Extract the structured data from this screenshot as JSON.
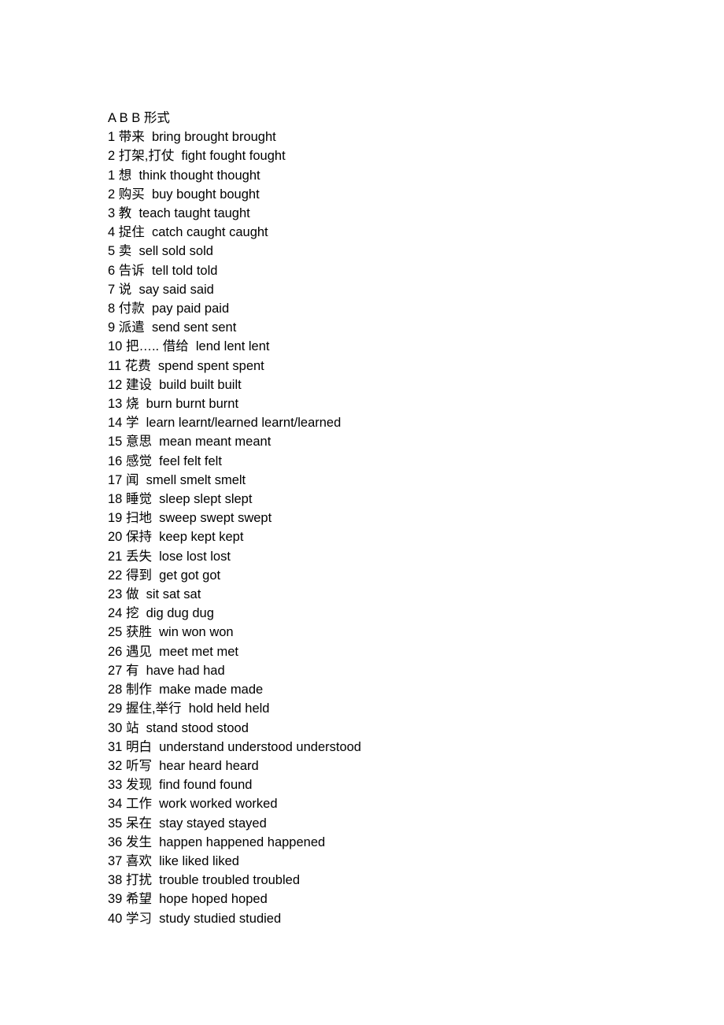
{
  "document": {
    "title": "A B B 形式",
    "background_color": "#ffffff",
    "text_color": "#000000",
    "separator_number_gloss": " ",
    "separator_gloss_forms": "  ",
    "entries": [
      {
        "number": "1",
        "gloss": "带来",
        "forms": "bring brought brought"
      },
      {
        "number": "2",
        "gloss": "打架,打仗",
        "forms": "fight fought fought"
      },
      {
        "number": "1",
        "gloss": "想",
        "forms": "think thought thought"
      },
      {
        "number": "2",
        "gloss": "购买",
        "forms": "buy bought bought"
      },
      {
        "number": "3",
        "gloss": "教",
        "forms": "teach taught taught"
      },
      {
        "number": "4",
        "gloss": "捉住",
        "forms": "catch caught caught"
      },
      {
        "number": "5",
        "gloss": "卖",
        "forms": "sell sold sold"
      },
      {
        "number": "6",
        "gloss": "告诉",
        "forms": "tell told told"
      },
      {
        "number": "7",
        "gloss": "说",
        "forms": "say said said"
      },
      {
        "number": "8",
        "gloss": "付款",
        "forms": "pay paid paid"
      },
      {
        "number": "9",
        "gloss": "派遣",
        "forms": "send sent sent"
      },
      {
        "number": "10",
        "gloss": "把….. 借给",
        "forms": "lend lent lent"
      },
      {
        "number": "11",
        "gloss": "花费",
        "forms": "spend spent spent"
      },
      {
        "number": "12",
        "gloss": "建设",
        "forms": "build built built"
      },
      {
        "number": "13",
        "gloss": "烧",
        "forms": "burn burnt burnt"
      },
      {
        "number": "14",
        "gloss": "学",
        "forms": "learn learnt/learned learnt/learned"
      },
      {
        "number": "15",
        "gloss": "意思",
        "forms": "mean meant meant"
      },
      {
        "number": "16",
        "gloss": "感觉",
        "forms": "feel felt felt"
      },
      {
        "number": "17",
        "gloss": "闻",
        "forms": "smell smelt smelt"
      },
      {
        "number": "18",
        "gloss": "睡觉",
        "forms": "sleep slept slept"
      },
      {
        "number": "19",
        "gloss": "扫地",
        "forms": "sweep swept swept"
      },
      {
        "number": "20",
        "gloss": "保持",
        "forms": "keep kept kept"
      },
      {
        "number": "21",
        "gloss": "丢失",
        "forms": "lose lost lost"
      },
      {
        "number": "22",
        "gloss": "得到",
        "forms": "get got got"
      },
      {
        "number": "23",
        "gloss": "做",
        "forms": "sit sat sat"
      },
      {
        "number": "24",
        "gloss": "挖",
        "forms": "dig dug dug"
      },
      {
        "number": "25",
        "gloss": "获胜",
        "forms": "win won won"
      },
      {
        "number": "26",
        "gloss": "遇见",
        "forms": "meet met met"
      },
      {
        "number": "27",
        "gloss": "有",
        "forms": "have had had"
      },
      {
        "number": "28",
        "gloss": "制作",
        "forms": "make made made"
      },
      {
        "number": "29",
        "gloss": "握住,举行",
        "forms": "hold held held"
      },
      {
        "number": "30",
        "gloss": "站",
        "forms": "stand stood stood"
      },
      {
        "number": "31",
        "gloss": "明白",
        "forms": "understand understood understood"
      },
      {
        "number": "32",
        "gloss": "听写",
        "forms": "hear heard heard"
      },
      {
        "number": "33",
        "gloss": "发现",
        "forms": "find found found"
      },
      {
        "number": "34",
        "gloss": "工作",
        "forms": "work worked worked"
      },
      {
        "number": "35",
        "gloss": "呆在",
        "forms": "stay stayed stayed"
      },
      {
        "number": "36",
        "gloss": "发生",
        "forms": "happen happened happened"
      },
      {
        "number": "37",
        "gloss": "喜欢",
        "forms": "like liked liked"
      },
      {
        "number": "38",
        "gloss": "打扰",
        "forms": "trouble troubled troubled"
      },
      {
        "number": "39",
        "gloss": "希望",
        "forms": "hope hoped hoped"
      },
      {
        "number": "40",
        "gloss": "学习",
        "forms": "study studied studied"
      }
    ]
  }
}
